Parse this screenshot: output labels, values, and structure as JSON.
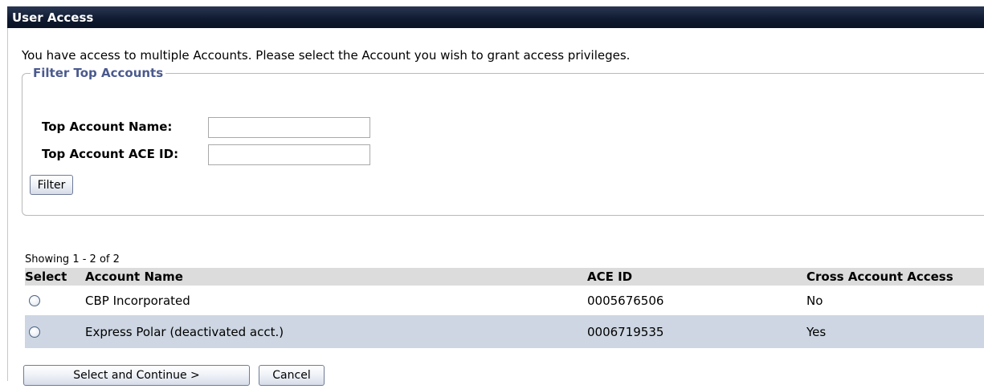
{
  "header": {
    "title": "User Access"
  },
  "intro_text": "You have access to multiple Accounts. Please select the Account you wish to grant access privileges.",
  "filter": {
    "legend": "Filter Top Accounts",
    "name_label": "Top Account Name:",
    "name_value": "",
    "ace_label": "Top Account ACE ID:",
    "ace_value": "",
    "filter_button": "Filter"
  },
  "results": {
    "showing": "Showing 1 - 2 of 2",
    "columns": [
      "Select",
      "Account Name",
      "ACE ID",
      "Cross Account Access"
    ],
    "rows": [
      {
        "account_name": "CBP Incorporated",
        "ace_id": "0005676506",
        "cross_access": "No"
      },
      {
        "account_name": "Express Polar (deactivated acct.)",
        "ace_id": "0006719535",
        "cross_access": "Yes"
      }
    ]
  },
  "actions": {
    "continue_button": "Select and Continue >",
    "cancel_button": "Cancel"
  },
  "colors": {
    "header_bg": "#0f1a30",
    "legend_text": "#4a5a8e",
    "alt_row_bg": "#cdd6e2",
    "grid_header_bg": "#dcdcdc"
  }
}
